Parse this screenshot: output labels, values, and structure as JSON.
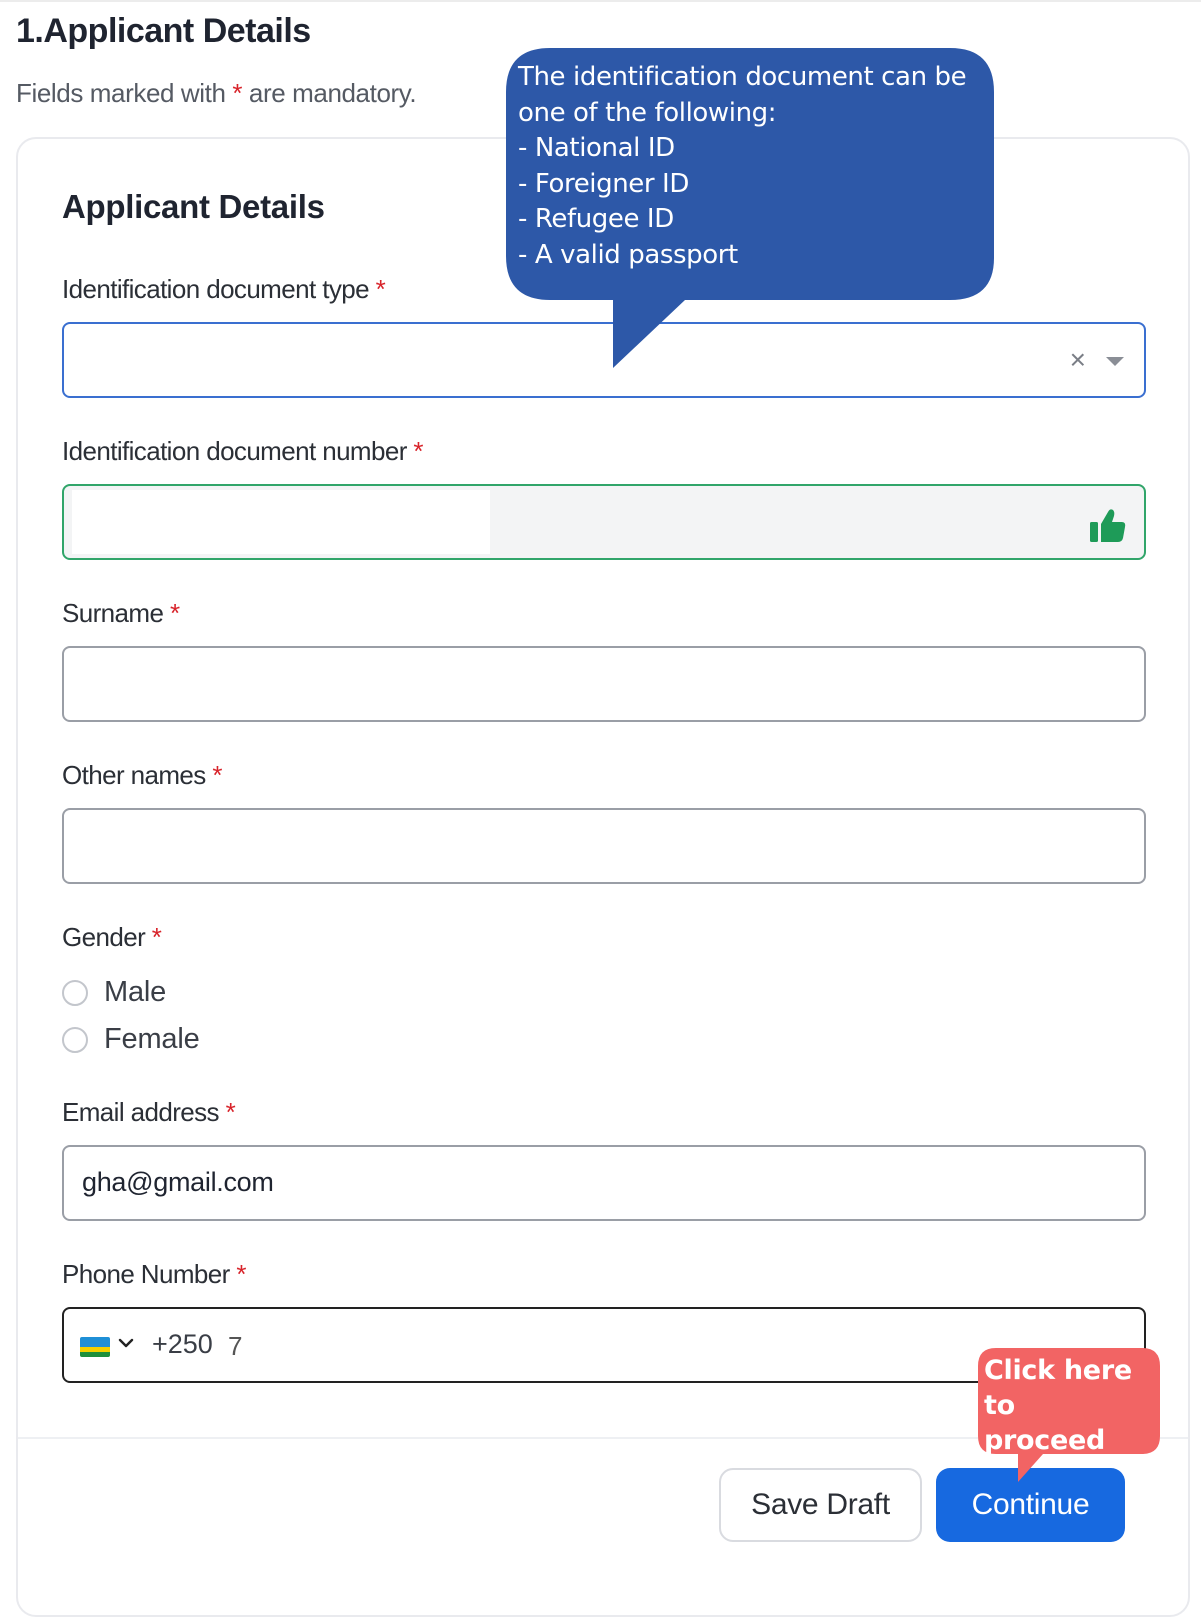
{
  "page": {
    "title": "1.Applicant Details",
    "mandatory_note_prefix": "Fields marked with",
    "mandatory_star": "*",
    "mandatory_note_suffix": "are mandatory."
  },
  "card": {
    "title": "Applicant Details"
  },
  "fields": {
    "id_type": {
      "label": "Identification document type",
      "value": "",
      "clear_glyph": "×"
    },
    "id_number": {
      "label": "Identification document number",
      "value": ""
    },
    "surname": {
      "label": "Surname",
      "value": ""
    },
    "other_names": {
      "label": "Other names",
      "value": ""
    },
    "gender": {
      "label": "Gender",
      "options": [
        "Male",
        "Female"
      ]
    },
    "email": {
      "label": "Email address",
      "value": "gha@gmail.com"
    },
    "phone": {
      "label": "Phone Number",
      "dial_code": "+250",
      "cursor": "7"
    }
  },
  "buttons": {
    "save_draft": "Save Draft",
    "continue": "Continue"
  },
  "tooltips": {
    "id_help": [
      "The identification document can be",
      "one of the following:",
      "- National ID",
      "- Foreigner ID",
      "- Refugee ID",
      "- A valid passport"
    ],
    "proceed": [
      "Click here to",
      "proceed"
    ]
  },
  "colors": {
    "tooltip_blue": "#2d58a8",
    "tooltip_red": "#f26464",
    "primary": "#1769e0",
    "valid_green": "#31a56a",
    "required_red": "#d8232a"
  },
  "icons": {
    "clear": "close-icon",
    "dropdown": "caret-down-icon",
    "valid": "thumbs-up-icon",
    "country_flag": "rwanda-flag-icon",
    "flag_dropdown": "chevron-down-icon"
  }
}
